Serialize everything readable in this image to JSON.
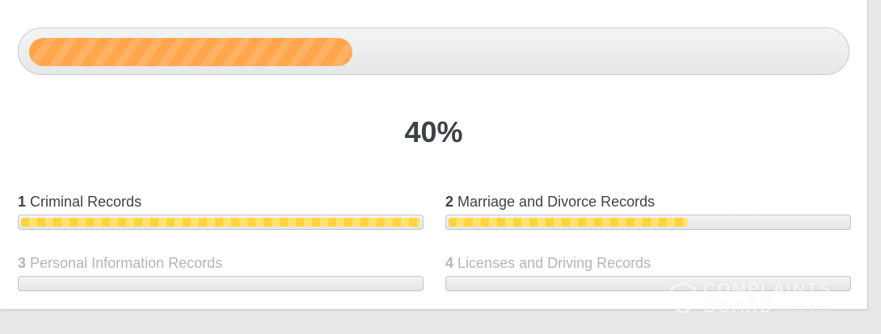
{
  "progress": {
    "value": 0.4,
    "label": "40%"
  },
  "steps": [
    {
      "number": "1",
      "label": "Criminal Records",
      "state": "active",
      "progress": 1.0
    },
    {
      "number": "2",
      "label": "Marriage and Divorce Records",
      "state": "active",
      "progress": 0.6
    },
    {
      "number": "3",
      "label": "Personal Information Records",
      "state": "pending",
      "progress": 0
    },
    {
      "number": "4",
      "label": "Licenses and Driving Records",
      "state": "pending",
      "progress": 0
    }
  ],
  "watermark": {
    "line1": "COMPLAINTS",
    "line2": "BOARD",
    "since": "SINCE 2004"
  },
  "colors": {
    "main_fill": "#ffa64d",
    "step_fill": "#fdd43d",
    "text_dark": "#3d4245",
    "text_muted": "#b3b5b8"
  },
  "icons": {
    "watermark_logo": "shield-check-icon"
  }
}
